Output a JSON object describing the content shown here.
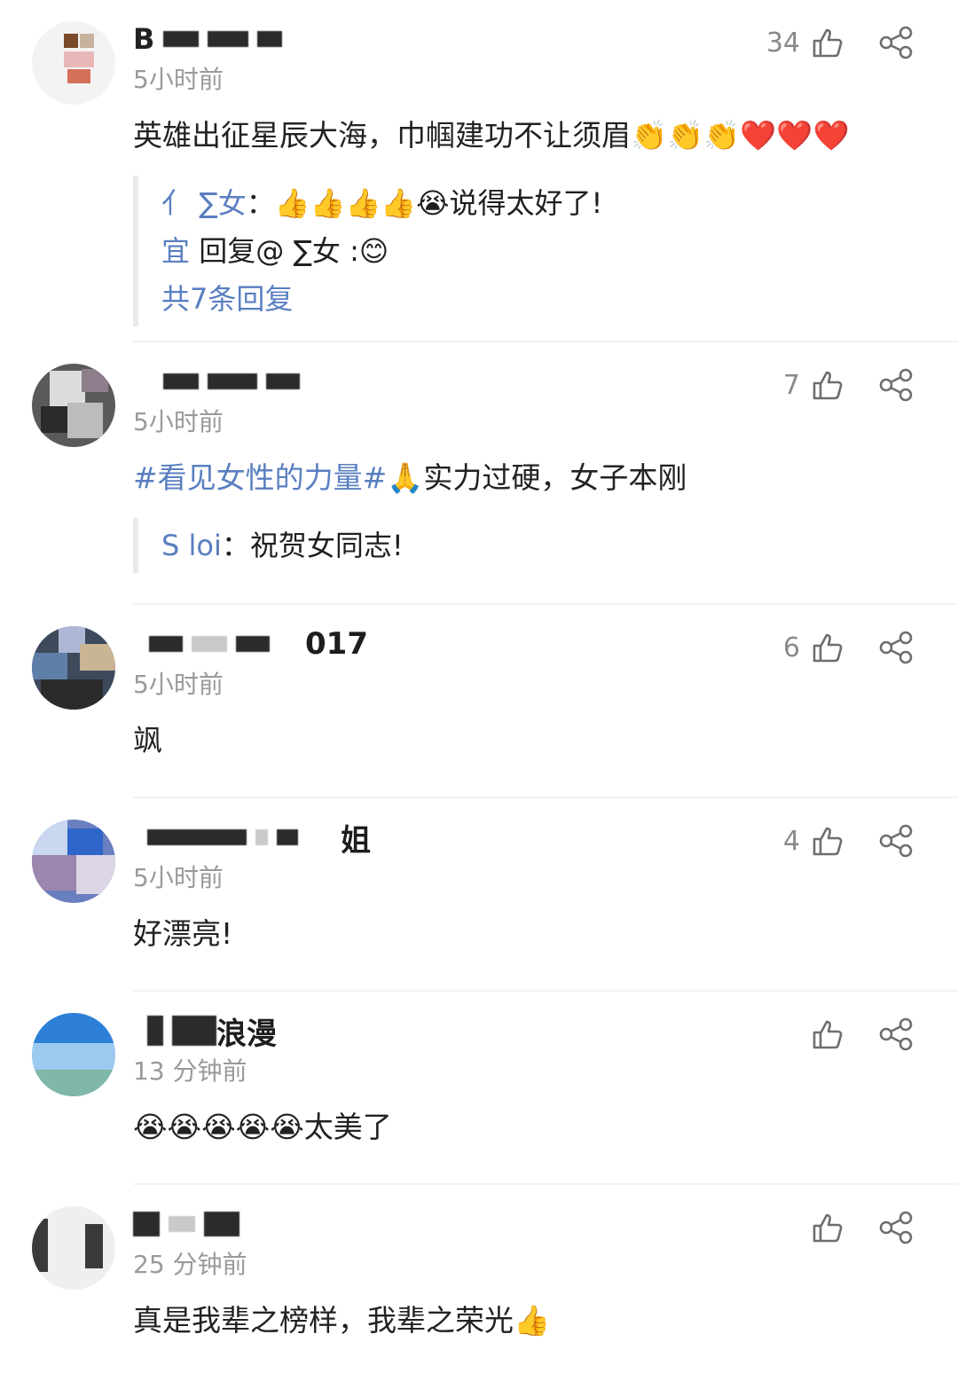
{
  "colors": {
    "link": "#5a7fc0",
    "muted": "#9a9a9a",
    "divider": "#f2f2f2"
  },
  "comments": [
    {
      "name_suffix": "",
      "time": "5小时前",
      "likes": "34",
      "content": "英雄出征星辰大海，巾帼建功不让须眉👏👏👏❤️❤️❤️",
      "replies": [
        {
          "user": "亻  ∑女",
          "sep": "：",
          "text": "👍👍👍👍😭说得太好了!"
        },
        {
          "user": "  宜",
          "sep": "",
          "text": "回复@  ∑女 :😊"
        }
      ],
      "more_replies": "共7条回复"
    },
    {
      "name_suffix": "",
      "time": "5小时前",
      "likes": "7",
      "hashtag": "#看见女性的力量#",
      "content": "🙏实力过硬，女子本刚",
      "replies": [
        {
          "user": "S  loi",
          "sep": "：",
          "text": "祝贺女同志!"
        }
      ]
    },
    {
      "name_suffix": "017",
      "time": "5小时前",
      "likes": "6",
      "content": "飒"
    },
    {
      "name_suffix": "姐",
      "time": "5小时前",
      "likes": "4",
      "content": "好漂亮!"
    },
    {
      "name_suffix": "浪漫",
      "time": "13 分钟前",
      "likes": "",
      "content": "😭😭😭😭😭太美了"
    },
    {
      "name_suffix": "",
      "time": "25 分钟前",
      "likes": "",
      "content": "真是我辈之榜样，我辈之荣光👍"
    }
  ]
}
